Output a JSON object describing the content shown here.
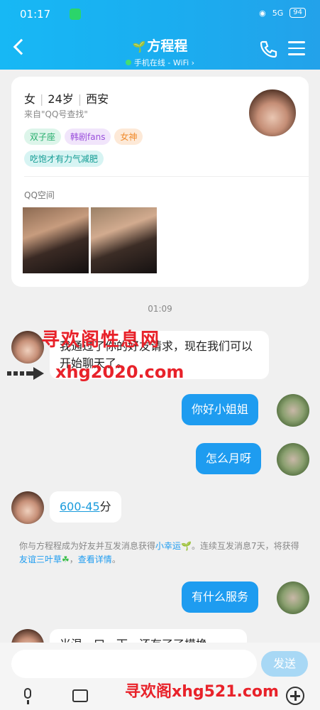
{
  "status_bar": {
    "time": "01:17",
    "signal": "5G",
    "battery": "94"
  },
  "header": {
    "title": "方程程",
    "subtitle": "手机在线 - WiFi",
    "subtitle_arrow": "›"
  },
  "profile": {
    "gender": "女",
    "age": "24岁",
    "city": "西安",
    "source": "来自\"QQ号查找\"",
    "tags": [
      "双子座",
      "韩剧fans",
      "女神",
      "吃饱才有力气减肥"
    ],
    "qzone_label": "QQ空间"
  },
  "chat": {
    "timestamp": "01:09",
    "msg1": "我通过了你的好友请求，现在我们可以开始聊天了。",
    "msg2": "你好小姐姐",
    "msg3": "怎么月呀",
    "msg4_link": "600-45",
    "msg4_suffix": "分",
    "system": {
      "p1": "你与方程程成为好友并互发消息获得",
      "b1": "小幸运",
      "p2": "。连续互发消息7天，将获得",
      "b2": "友谊三叶草",
      "p3": "，",
      "b3": "查看详情",
      "p4": "。"
    },
    "msg5": "有什么服务",
    "msg6_partial": "当温一口一下，还有了了模换"
  },
  "input": {
    "send_label": "发送"
  },
  "watermark": {
    "line1": "寻欢阁性息网",
    "line2": "xhg2020.com",
    "line3": "寻欢阁xhg521.com"
  },
  "icons": [
    "back-icon",
    "phone-icon",
    "menu-icon",
    "mic-icon",
    "image-icon",
    "plus-icon"
  ]
}
